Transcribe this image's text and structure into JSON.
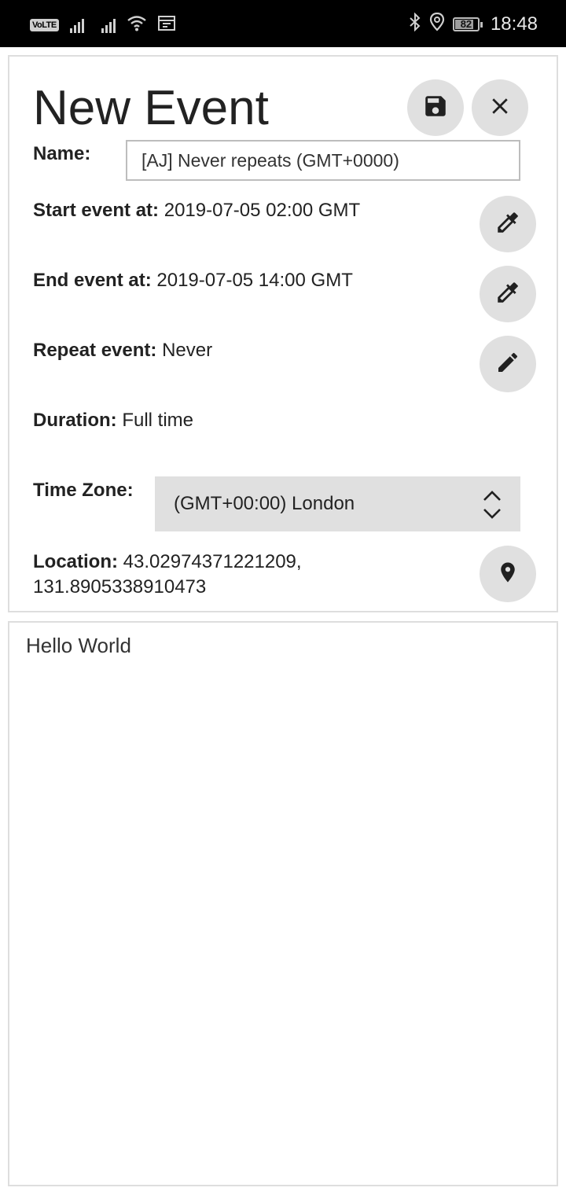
{
  "status_bar": {
    "volte": "VoLTE",
    "battery_level": "82",
    "battery_fraction": 0.82,
    "time": "18:48",
    "icons": [
      "signal-icon",
      "signal-icon",
      "wifi-icon",
      "calendar-icon",
      "bluetooth-icon",
      "location-icon",
      "battery-icon"
    ]
  },
  "form": {
    "title": "New Event",
    "save_icon": "save-icon",
    "close_icon": "close-icon",
    "name_label": "Name:",
    "name_value": "[AJ] Never repeats (GMT+0000)",
    "start_label": "Start event at:",
    "start_value": "2019-07-05 02:00 GMT",
    "end_label": "End event at:",
    "end_value": "2019-07-05 14:00 GMT",
    "repeat_label": "Repeat event:",
    "repeat_value": "Never",
    "duration_label": "Duration:",
    "duration_value": "Full time",
    "timezone_label": "Time Zone:",
    "timezone_value": "(GMT+00:00) London",
    "location_label": "Location:",
    "location_value_line1": "43.02974371221209,",
    "location_value_line2": "131.8905338910473"
  },
  "notes": {
    "text": "Hello World"
  },
  "colors": {
    "status_bar_bg": "#000000",
    "button_bg": "#e0e0e0",
    "border": "#dedede",
    "text": "#212121"
  }
}
